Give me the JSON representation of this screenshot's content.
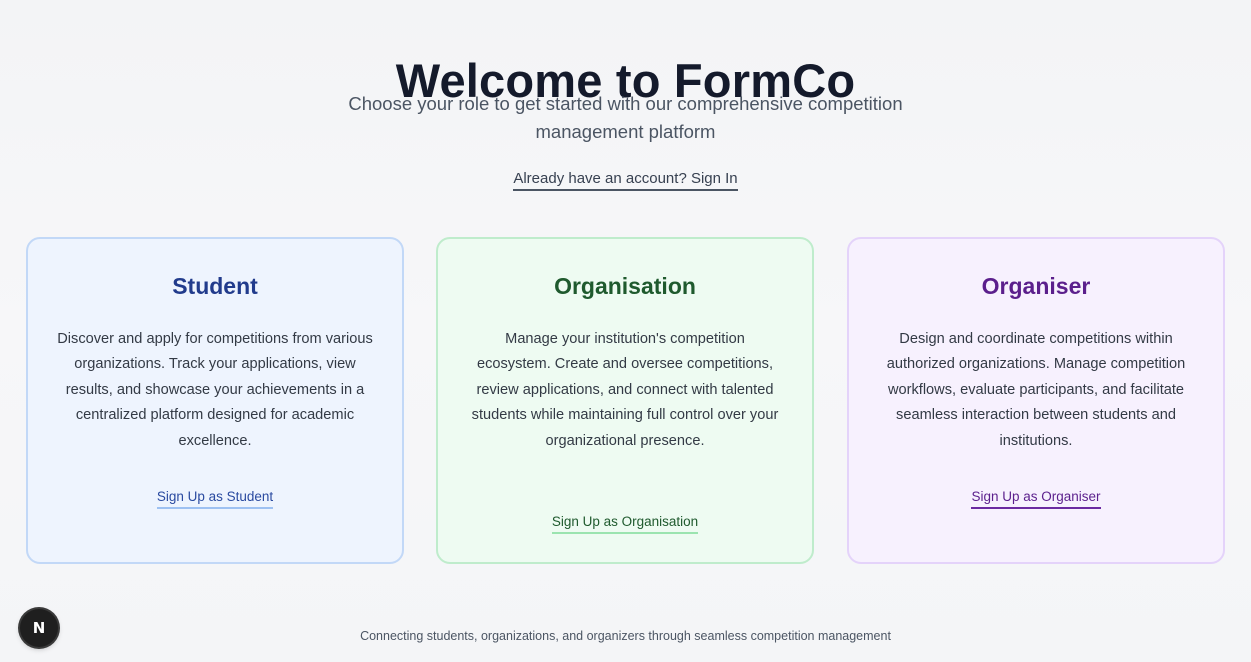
{
  "header": {
    "title": "Welcome to FormCo",
    "subtitle": "Choose your role to get started with our comprehensive competition management platform",
    "signin_link": "Already have an account? Sign In"
  },
  "cards": [
    {
      "title": "Student",
      "description": "Discover and apply for competitions from various organizations. Track your applications, view results, and showcase your achievements in a centralized platform designed for academic excellence.",
      "cta": "Sign Up as Student"
    },
    {
      "title": "Organisation",
      "description": "Manage your institution's competition ecosystem. Create and oversee competitions, review applications, and connect with talented students while maintaining full control over your organizational presence.",
      "cta": "Sign Up as Organisation"
    },
    {
      "title": "Organiser",
      "description": "Design and coordinate competitions within authorized organizations. Manage competition workflows, evaluate participants, and facilitate seamless interaction between students and institutions.",
      "cta": "Sign Up as Organiser"
    }
  ],
  "footer": {
    "text": "Connecting students, organizations, and organizers through seamless competition management"
  },
  "dev_badge": {
    "icon": "next-logo-icon",
    "letter": "N"
  },
  "colors": {
    "student_accent": "#213b8c",
    "organisation_accent": "#1f5a2e",
    "organiser_accent": "#5b1f8c"
  }
}
